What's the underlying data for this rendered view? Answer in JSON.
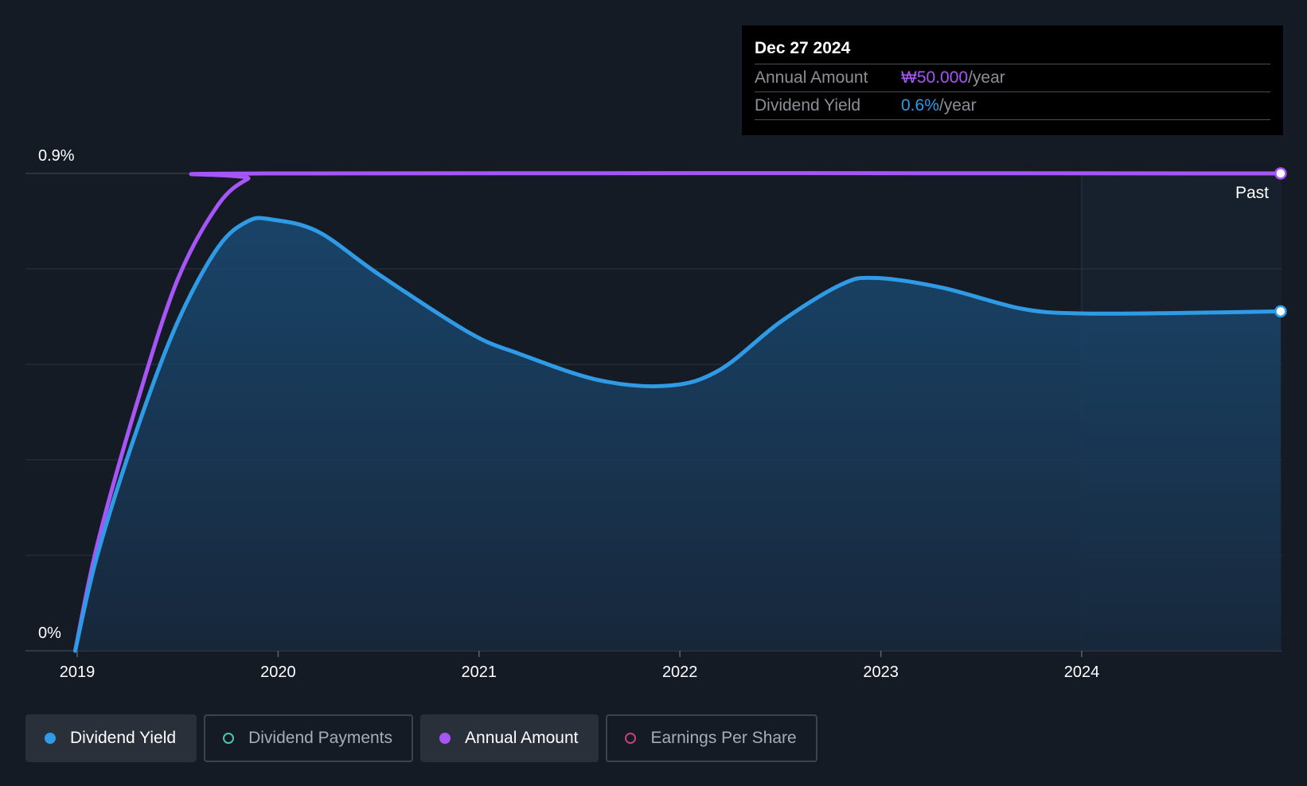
{
  "tooltip": {
    "date": "Dec 27 2024",
    "rows": [
      {
        "label": "Annual Amount",
        "value": "₩50.000",
        "suffix": "/year"
      },
      {
        "label": "Dividend Yield",
        "value": "0.6%",
        "suffix": "/year"
      }
    ]
  },
  "legend": [
    {
      "label": "Dividend Yield",
      "color": "#2f9be6",
      "active": true,
      "filled": true
    },
    {
      "label": "Dividend Payments",
      "color": "#4fc1b0",
      "active": false,
      "filled": false
    },
    {
      "label": "Annual Amount",
      "color": "#a855f7",
      "active": true,
      "filled": true
    },
    {
      "label": "Earnings Per Share",
      "color": "#c2427a",
      "active": false,
      "filled": false
    }
  ],
  "chart_data": {
    "type": "area",
    "x_ticks": [
      "2019",
      "2020",
      "2021",
      "2022",
      "2023",
      "2024"
    ],
    "y_ticks": [
      "0%",
      "0.9%"
    ],
    "ylim": [
      0,
      0.9
    ],
    "xlim": [
      2018.99,
      2024.99
    ],
    "grid": true,
    "past_label": "Past",
    "past_start": 2024.0,
    "series": [
      {
        "name": "Dividend Yield",
        "color": "#2f9be6",
        "unit": "%",
        "x": [
          2018.99,
          2019.1,
          2019.3,
          2019.5,
          2019.7,
          2019.85,
          2019.97,
          2020.2,
          2020.5,
          2020.95,
          2021.2,
          2021.6,
          2021.95,
          2022.2,
          2022.5,
          2022.8,
          2022.97,
          2023.3,
          2023.7,
          2024.0,
          2024.5,
          2024.99
        ],
        "y": [
          0.0,
          0.18,
          0.42,
          0.62,
          0.76,
          0.81,
          0.813,
          0.79,
          0.71,
          0.6,
          0.56,
          0.51,
          0.5,
          0.53,
          0.62,
          0.69,
          0.703,
          0.685,
          0.645,
          0.636,
          0.637,
          0.64
        ]
      },
      {
        "name": "Annual Amount",
        "color": "#a855f7",
        "unit": "₩",
        "x": [
          2018.99,
          2019.1,
          2019.3,
          2019.5,
          2019.7,
          2019.85,
          2019.97,
          2024.99
        ],
        "y": [
          0.0,
          0.2,
          0.47,
          0.7,
          0.84,
          0.89,
          0.9,
          0.9
        ]
      }
    ]
  }
}
